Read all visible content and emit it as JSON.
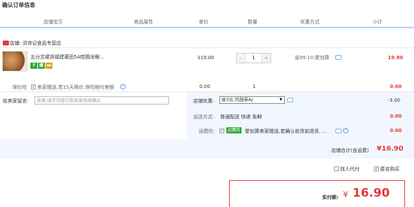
{
  "page": {
    "title": "确认订单信息"
  },
  "header": {
    "col_item": "店铺宝贝",
    "col_attr": "商品属性",
    "col_price": "单价",
    "col_qty": "数量",
    "col_discount": "优惠方式",
    "col_subtotal": "小计"
  },
  "shop": {
    "name": "店铺: 洪寺记食品专营店"
  },
  "item": {
    "name": "五分文裙货福建莆田5A桂圆龙眼...",
    "price": "119.00",
    "quantity": "1",
    "qty_minus": "-",
    "qty_plus": "+",
    "discount": "省99.10:聚划算",
    "subtotal": "19.90",
    "badges": [
      {
        "label": "7",
        "color": "#2eaa3a"
      },
      {
        "label": "赠",
        "color": "#2eaa3a"
      },
      {
        "label": "",
        "color": "#e8a21a"
      }
    ]
  },
  "insurance": {
    "label": "保价险",
    "checkbox_text": "卖家赠送,若15天降价,保险赔付差额",
    "price": "0.00",
    "quantity": "1",
    "subtotal": "0.00"
  },
  "message": {
    "label": "给卖家留言:",
    "placeholder": "选填:填写内容已和卖家协商确认"
  },
  "shop_coupon": {
    "label": "店铺优惠:",
    "selected": "省3元:内部券AJ",
    "value": "-3.00"
  },
  "shipping": {
    "label": "运送方式:",
    "text": "普通配送 快递 免邮",
    "value": "0.00"
  },
  "freight_insurance": {
    "label": "运费险:",
    "tag": "运费险",
    "text": "聚划算卖家赠送,若确认收货前退货, ...",
    "value": "0.00"
  },
  "total": {
    "label": "店铺合计(含运费)",
    "amount": "¥16.90"
  },
  "options": {
    "pay_for_other": "找人代付",
    "anonymous": "匿名购买"
  },
  "payment": {
    "label": "实付款:",
    "currency": "¥",
    "amount": "16.90"
  },
  "colors": {
    "accent_red": "#e4393c",
    "panel_blue": "#f2f7ff",
    "header_line": "#b2d1ff"
  }
}
